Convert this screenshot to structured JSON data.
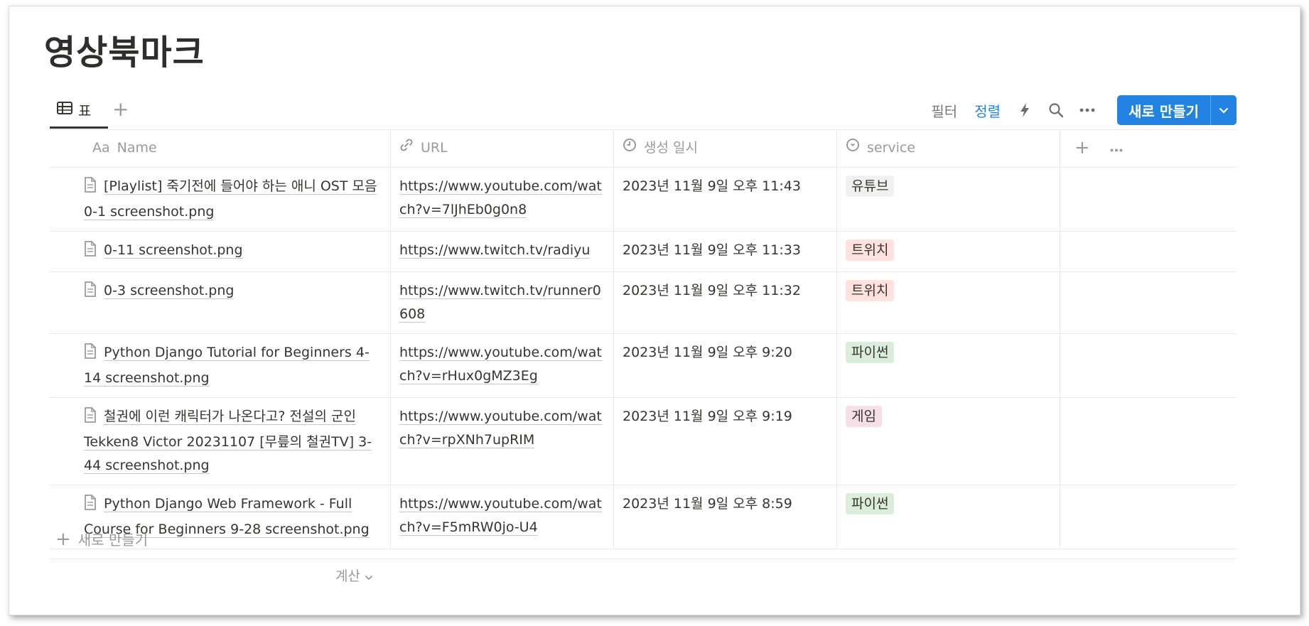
{
  "page": {
    "title": "영상북마크"
  },
  "views": {
    "table_label": "표"
  },
  "toolbar": {
    "filter_label": "필터",
    "sort_label": "정렬",
    "new_label": "새로 만들기"
  },
  "columns": {
    "name": "Name",
    "url": "URL",
    "created": "생성 일시",
    "service": "service"
  },
  "name_prefix": "Aa",
  "rows": [
    {
      "name": "[Playlist] 죽기전에 들어야 하는 애니 OST 모음 0-1 screenshot.png",
      "url": "https://www.youtube.com/watch?v=7lJhEb0g0n8",
      "created": "2023년 11월 9일 오후 11:43",
      "service": "유튜브",
      "service_bg": "#f1f1ef"
    },
    {
      "name": "0-11 screenshot.png",
      "url": "https://www.twitch.tv/radiyu",
      "created": "2023년 11월 9일 오후 11:33",
      "service": "트위치",
      "service_bg": "#ffe2dd"
    },
    {
      "name": "0-3 screenshot.png",
      "url": "https://www.twitch.tv/runner0608",
      "created": "2023년 11월 9일 오후 11:32",
      "service": "트위치",
      "service_bg": "#ffe2dd"
    },
    {
      "name": "Python Django Tutorial for Beginners 4-14 screenshot.png",
      "url": "https://www.youtube.com/watch?v=rHux0gMZ3Eg",
      "created": "2023년 11월 9일 오후 9:20",
      "service": "파이썬",
      "service_bg": "#dbeddb"
    },
    {
      "name": "철권에 이런 캐릭터가 나온다고? 전설의 군인 Tekken8 Victor 20231107 [무릎의 철권TV] 3-44 screenshot.png",
      "url": "https://www.youtube.com/watch?v=rpXNh7upRIM",
      "created": "2023년 11월 9일 오후 9:19",
      "service": "게임",
      "service_bg": "#f5e0e9"
    },
    {
      "name": "Python Django Web Framework - Full Course for Beginners 9-28 screenshot.png",
      "url": "https://www.youtube.com/watch?v=F5mRW0jo-U4",
      "created": "2023년 11월 9일 오후 8:59",
      "service": "파이썬",
      "service_bg": "#dbeddb"
    }
  ],
  "footer": {
    "add_row_label": "새로 만들기",
    "calc_label": "계산"
  },
  "colors": {
    "accent": "#2383e2",
    "text": "#37352f",
    "muted": "#9b9a97"
  }
}
